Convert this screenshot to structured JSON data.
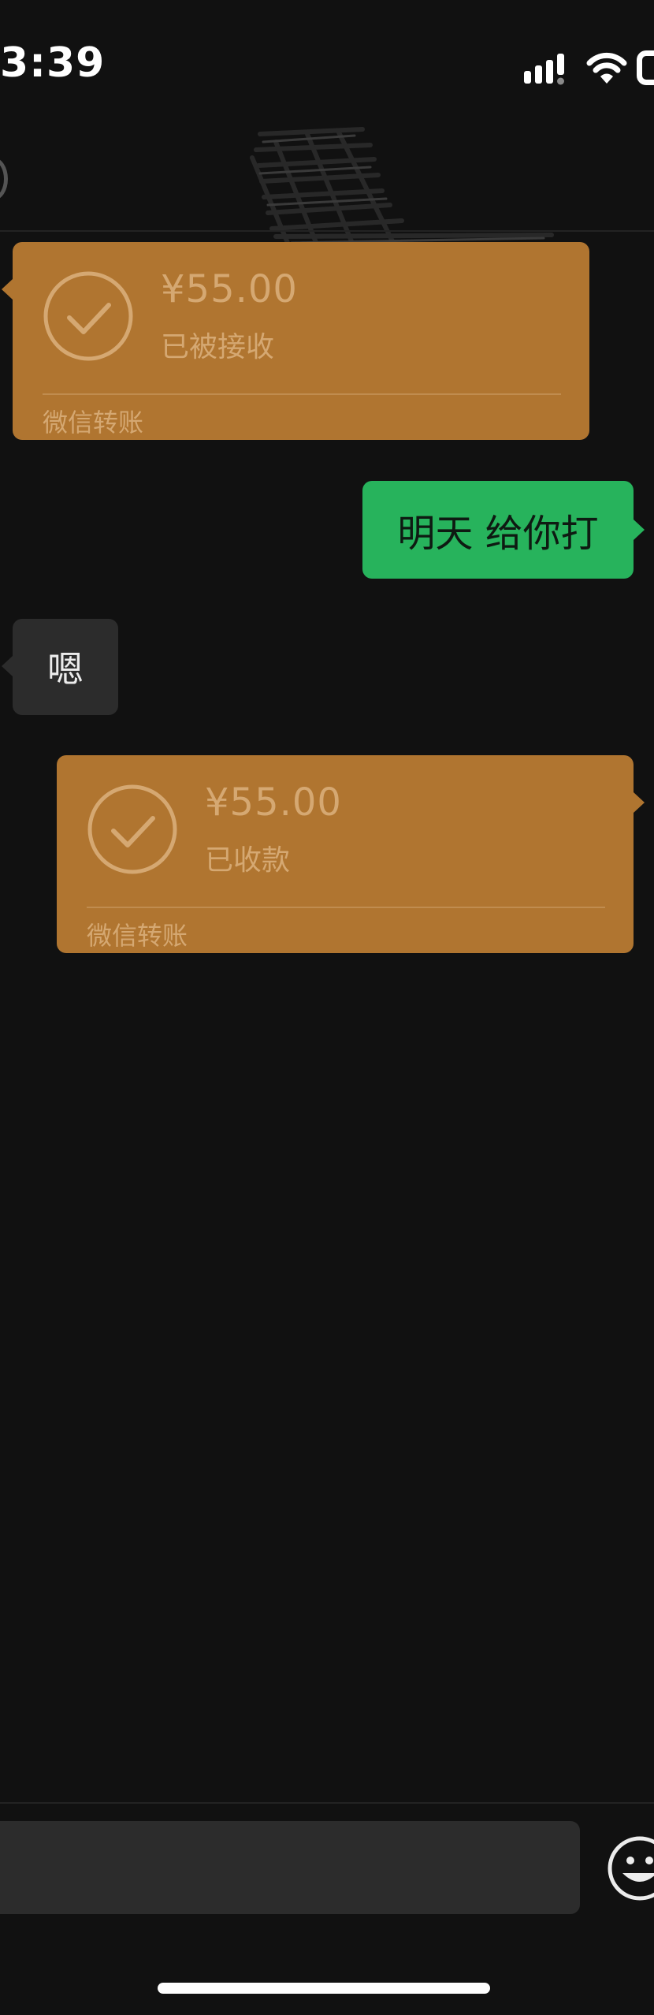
{
  "status_bar": {
    "time": "3:39",
    "icons": [
      "signal-icon",
      "wifi-icon",
      "battery-icon"
    ]
  },
  "nav": {
    "title_redacted": true,
    "back_icon": "back-icon"
  },
  "messages": [
    {
      "type": "transfer",
      "side": "left",
      "amount": "¥55.00",
      "status": "已被接收",
      "footer": "微信转账"
    },
    {
      "type": "text",
      "side": "right",
      "text": "明天 给你打"
    },
    {
      "type": "text",
      "side": "left",
      "text": "嗯"
    },
    {
      "type": "transfer",
      "side": "right",
      "amount": "¥55.00",
      "status": "已收款",
      "footer": "微信转账"
    }
  ],
  "input_bar": {
    "value": "",
    "emoji_icon": "emoji-icon"
  },
  "colors": {
    "background": "#111111",
    "transfer_card": "#b07530",
    "transfer_text": "#d5a872",
    "sent_bubble": "#27b35c",
    "received_bubble": "#2c2c2c"
  }
}
